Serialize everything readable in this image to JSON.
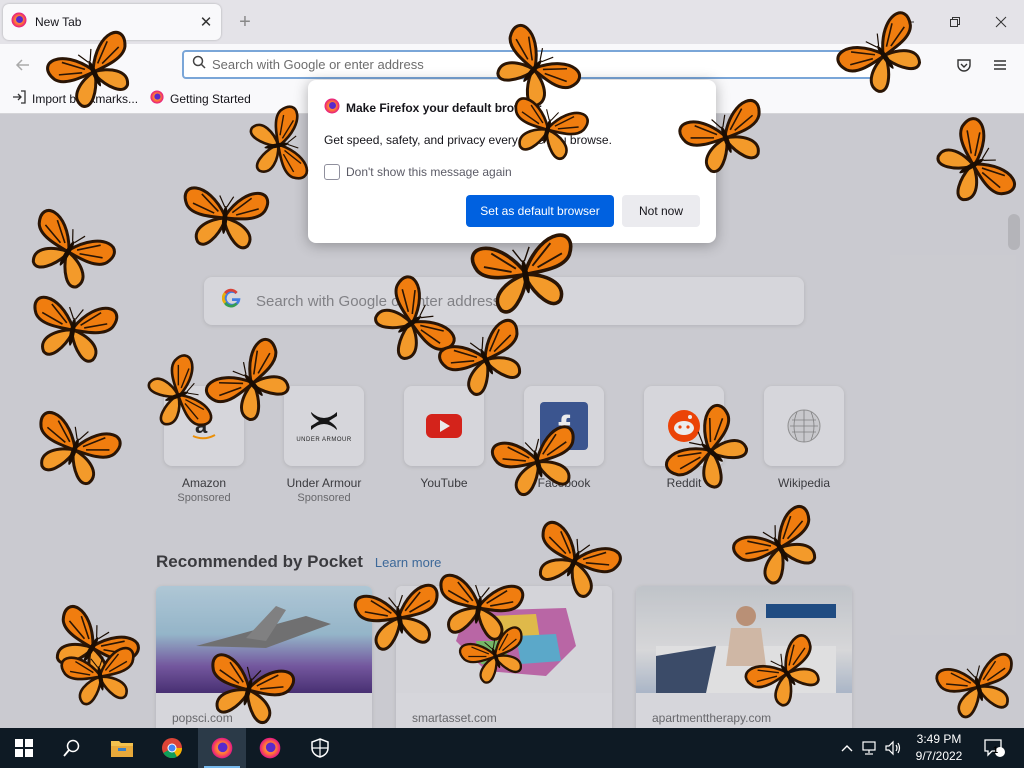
{
  "browser": {
    "tab_title": "New Tab",
    "url_placeholder": "Search with Google or enter address",
    "bookmarks": [
      {
        "label": "Import bookmarks..."
      },
      {
        "label": "Getting Started"
      }
    ]
  },
  "page": {
    "search_placeholder": "Search with Google or enter address",
    "top_sites": [
      {
        "label": "Amazon",
        "sub": "Sponsored",
        "icon": "amazon-icon"
      },
      {
        "label": "Under Armour",
        "sub": "Sponsored",
        "icon": "under-armour-icon",
        "icon_text": "UNDER ARMOUR"
      },
      {
        "label": "YouTube",
        "sub": "",
        "icon": "youtube-icon"
      },
      {
        "label": "Facebook",
        "sub": "",
        "icon": "facebook-icon",
        "icon_text": "f"
      },
      {
        "label": "Reddit",
        "sub": "",
        "icon": "reddit-icon"
      },
      {
        "label": "Wikipedia",
        "sub": "",
        "icon": "wikipedia-icon"
      }
    ],
    "pocket_title": "Recommended by Pocket",
    "pocket_link": "Learn more",
    "cards": [
      {
        "source": "popsci.com"
      },
      {
        "source": "smartasset.com"
      },
      {
        "source": "apartmenttherapy.com"
      }
    ]
  },
  "dialog": {
    "title": "Make Firefox your default browser",
    "body": "Get speed, safety, and privacy every time you browse.",
    "checkbox_label": "Don't show this message again",
    "primary_button": "Set as default browser",
    "secondary_button": "Not now"
  },
  "taskbar": {
    "time": "3:49 PM",
    "date": "9/7/2022",
    "notification_count": "1"
  },
  "colors": {
    "accent": "#0061e0",
    "butterfly_orange": "#f07d0f",
    "taskbar": "#0e1a24"
  }
}
